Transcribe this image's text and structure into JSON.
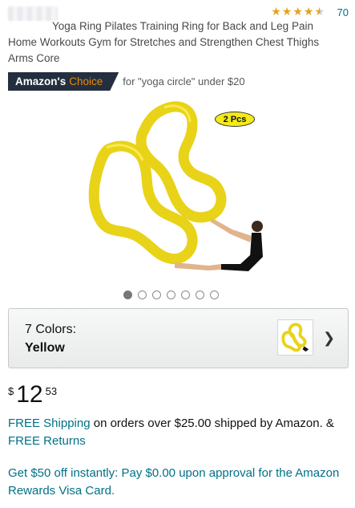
{
  "product": {
    "rating_count": "70",
    "stars": [
      "full",
      "full",
      "full",
      "full",
      "half"
    ],
    "title": "Yoga Ring Pilates Training Ring for Back and Leg Pain Home Workouts Gym for Stretches and Strengthen Chest Thighs Arms Core",
    "badge": {
      "prefix": "Amazon's",
      "choice": "Choice",
      "for_text": "for \"yoga circle\" under $20"
    },
    "image": {
      "tag": "2 Pcs",
      "ring_color": "#f4e21c",
      "dots": 7,
      "active_dot": 0
    }
  },
  "colors": {
    "count_label": "7 Colors:",
    "selected": "Yellow"
  },
  "price": {
    "currency": "$",
    "whole": "12",
    "fraction": "53"
  },
  "shipping": {
    "free_shipping": "FREE Shipping",
    "text": " on orders over $25.00 shipped by Amazon. & ",
    "free_returns": "FREE Returns"
  },
  "promo": {
    "text": "Get $50 off instantly: Pay $0.00 upon approval for the Amazon Rewards Visa Card."
  }
}
